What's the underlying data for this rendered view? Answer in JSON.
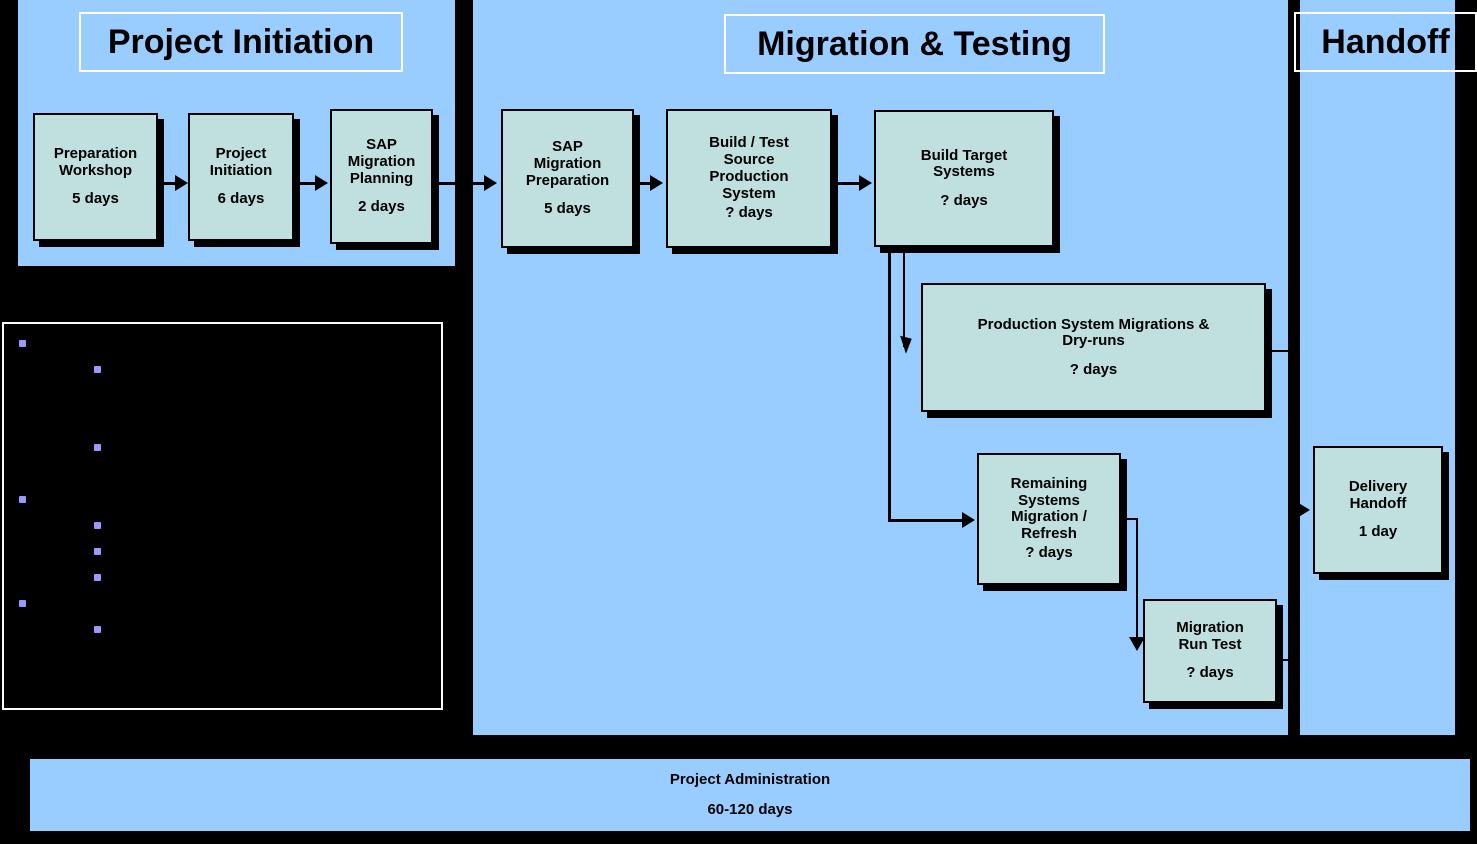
{
  "diagram": {
    "colors": {
      "panel_blue": "#99CCFF",
      "task_fill": "#BFE0DE",
      "bullet": "#9999FF",
      "background": "#000000",
      "outline": "#000000",
      "title_border": "#FFFFFF"
    }
  },
  "phases": [
    {
      "id": "project-initiation",
      "title": "Project Initiation"
    },
    {
      "id": "migration-testing",
      "title": "Migration & Testing"
    },
    {
      "id": "handoff",
      "title": "Handoff"
    }
  ],
  "tasks": [
    {
      "id": "preparation-workshop",
      "label": "Preparation\nWorkshop",
      "duration": "5 days",
      "phase": "project-initiation"
    },
    {
      "id": "project-initiation",
      "label": "Project\nInitiation",
      "duration": "6 days",
      "phase": "project-initiation"
    },
    {
      "id": "sap-migration-planning",
      "label": "SAP\nMigration\nPlanning",
      "duration": "2 days",
      "phase": "project-initiation"
    },
    {
      "id": "sap-migration-preparation",
      "label": "SAP\nMigration\nPreparation",
      "duration": "5 days",
      "phase": "migration-testing"
    },
    {
      "id": "build-test-source-production-system",
      "label": "Build / Test\nSource\nProduction\nSystem",
      "duration": "? days",
      "phase": "migration-testing"
    },
    {
      "id": "build-target-systems",
      "label": "Build Target\nSystems",
      "duration": "? days",
      "phase": "migration-testing"
    },
    {
      "id": "production-system-migrations-dry-runs",
      "label": "Production System Migrations &\nDry-runs",
      "duration": "? days",
      "phase": "migration-testing"
    },
    {
      "id": "remaining-systems-migration-refresh",
      "label": "Remaining\nSystems\nMigration /\nRefresh",
      "duration": "? days",
      "phase": "migration-testing"
    },
    {
      "id": "migration-run-test",
      "label": "Migration\nRun Test",
      "duration": "? days",
      "phase": "migration-testing"
    },
    {
      "id": "delivery-handoff",
      "label": "Delivery\nHandoff",
      "duration": "1 day",
      "phase": "handoff"
    }
  ],
  "admin": {
    "label": "Project Administration",
    "duration": "60-120 days"
  },
  "notes": {
    "bullets": [
      {
        "level": 1,
        "text": ""
      },
      {
        "level": 2,
        "text": ""
      },
      {
        "level": 2,
        "text": ""
      },
      {
        "level": 1,
        "text": ""
      },
      {
        "level": 2,
        "text": ""
      },
      {
        "level": 2,
        "text": ""
      },
      {
        "level": 2,
        "text": ""
      },
      {
        "level": 1,
        "text": ""
      },
      {
        "level": 2,
        "text": ""
      }
    ]
  }
}
